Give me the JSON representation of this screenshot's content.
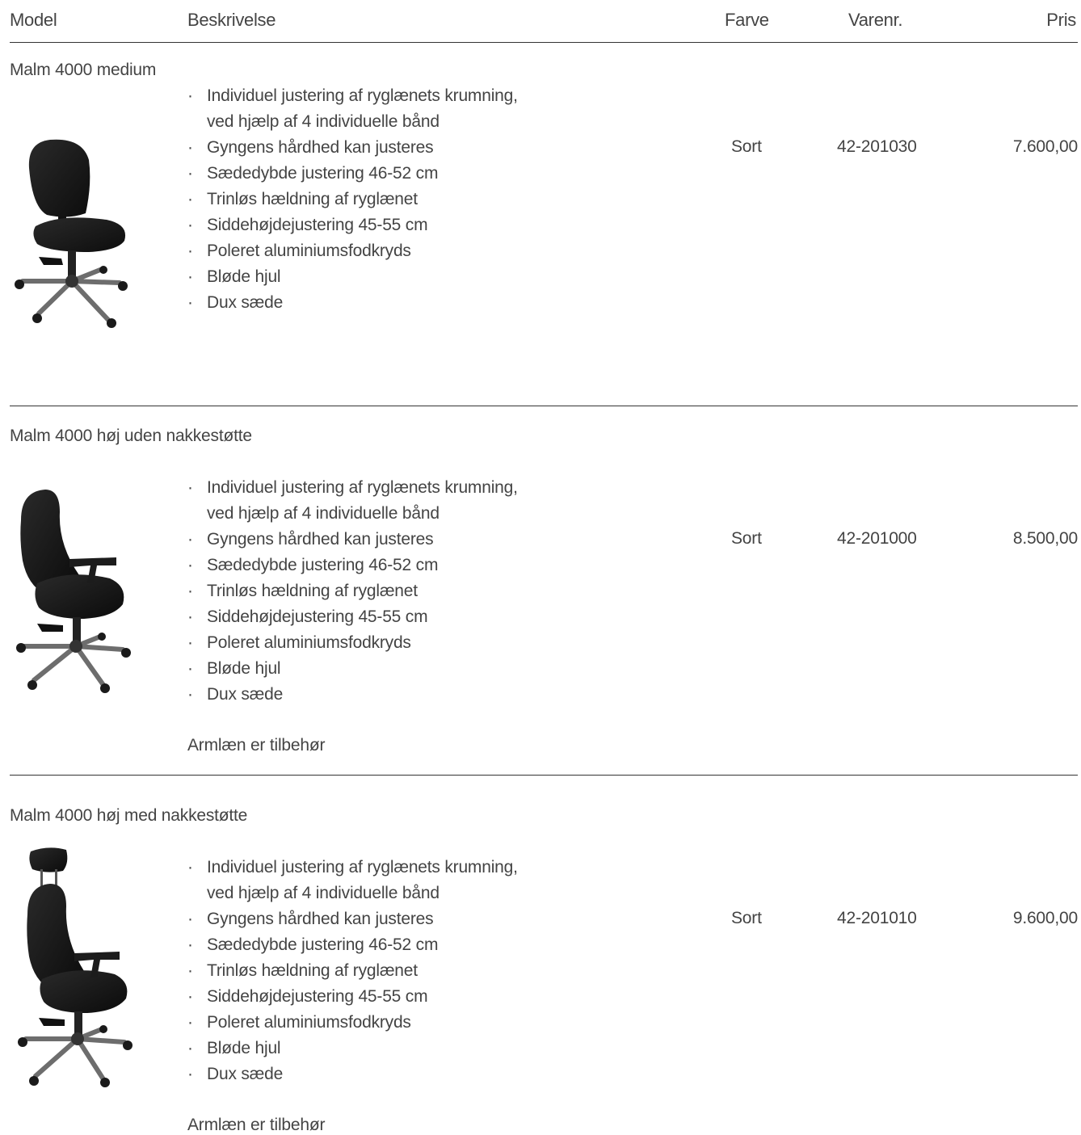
{
  "header": {
    "model": "Model",
    "description": "Beskrivelse",
    "color": "Farve",
    "sku": "Varenr.",
    "price": "Pris"
  },
  "products": [
    {
      "name": "Malm 4000 medium",
      "features": [
        [
          "Individuel justering af ryglænets krumning,",
          "ved hjælp af 4 individuelle bånd"
        ],
        [
          "Gyngens hårdhed kan justeres"
        ],
        [
          "Sædedybde justering 46-52 cm"
        ],
        [
          "Trinløs hældning af ryglænet"
        ],
        [
          "Siddehøjdejustering 45-55 cm"
        ],
        [
          "Poleret aluminiumsfodkryds"
        ],
        [
          "Bløde hjul"
        ],
        [
          "Dux sæde"
        ]
      ],
      "color": "Sort",
      "sku": "42-201030",
      "price": "7.600,00",
      "note": "",
      "image": "office-chair-medium-back"
    },
    {
      "name": "Malm 4000 høj uden nakkestøtte",
      "features": [
        [
          "Individuel justering af ryglænets krumning,",
          "ved hjælp af 4 individuelle bånd"
        ],
        [
          "Gyngens hårdhed kan justeres"
        ],
        [
          "Sædedybde justering 46-52 cm"
        ],
        [
          "Trinløs hældning af ryglænet"
        ],
        [
          "Siddehøjdejustering 45-55 cm"
        ],
        [
          "Poleret aluminiumsfodkryds"
        ],
        [
          "Bløde hjul"
        ],
        [
          "Dux sæde"
        ]
      ],
      "color": "Sort",
      "sku": "42-201000",
      "price": "8.500,00",
      "note": "Armlæn er tilbehør",
      "image": "office-chair-high-back-armrests"
    },
    {
      "name": "Malm 4000 høj med nakkestøtte",
      "features": [
        [
          "Individuel justering af ryglænets krumning,",
          "ved hjælp af 4 individuelle bånd"
        ],
        [
          "Gyngens hårdhed kan justeres"
        ],
        [
          "Sædedybde justering 46-52 cm"
        ],
        [
          "Trinløs hældning af ryglænet"
        ],
        [
          "Siddehøjdejustering 45-55 cm"
        ],
        [
          "Poleret aluminiumsfodkryds"
        ],
        [
          "Bløde hjul"
        ],
        [
          "Dux sæde"
        ]
      ],
      "color": "Sort",
      "sku": "42-201010",
      "price": "9.600,00",
      "note": "Armlæn er tilbehør",
      "image": "office-chair-high-back-headrest"
    }
  ]
}
